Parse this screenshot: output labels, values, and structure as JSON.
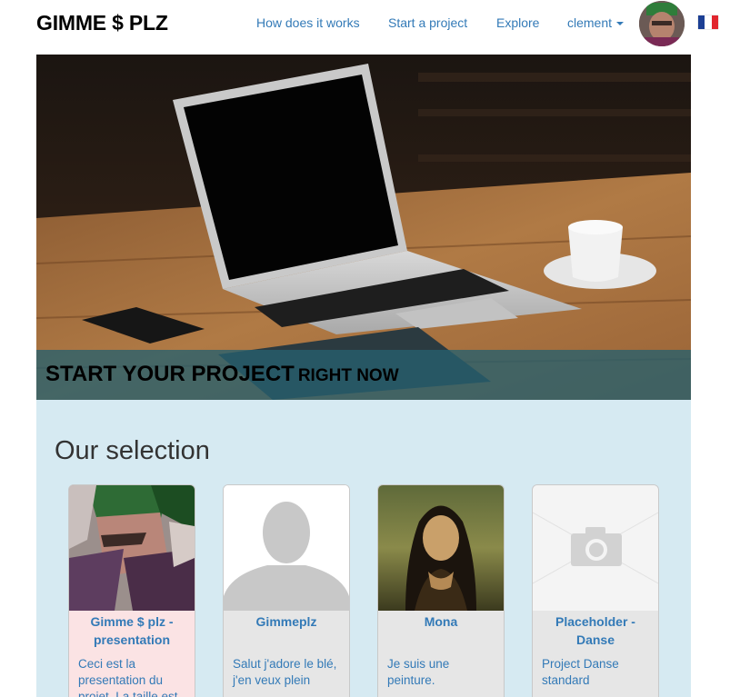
{
  "navbar": {
    "brand": "GIMME $ PLZ",
    "links": [
      "How does it works",
      "Start a project",
      "Explore"
    ],
    "user_menu": "clement"
  },
  "hero": {
    "title_big": "START YOUR PROJECT",
    "title_small": "RIGHT NOW"
  },
  "selection": {
    "heading": "Our selection",
    "cards": [
      {
        "title": "Gimme $ plz - presentation",
        "description": "Ceci est la presentation du projet. La taille est"
      },
      {
        "title": "Gimmeplz",
        "description": "Salut j'adore le blé, j'en veux plein"
      },
      {
        "title": "Mona",
        "description": "Je suis une peinture."
      },
      {
        "title": "Placeholder - Danse",
        "description": "Project Danse standard"
      }
    ]
  },
  "colors": {
    "link": "#337ab7",
    "selection_bg": "#d6eaf2",
    "hero_band": "#26606e"
  }
}
